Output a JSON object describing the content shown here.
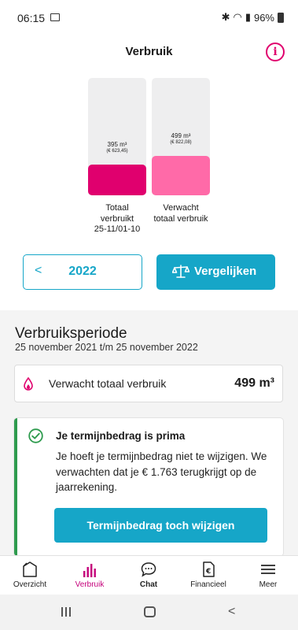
{
  "status_bar": {
    "time": "06:15",
    "battery": "96%"
  },
  "header": {
    "title": "Verbruik",
    "info_icon": "info-icon"
  },
  "chart_data": {
    "type": "bar",
    "categories": [
      "Totaal verbruikt 25-11/01-10",
      "Verwacht totaal verbruik"
    ],
    "values": [
      395,
      499
    ],
    "value_labels": [
      "395 m³",
      "499 m³"
    ],
    "cost_labels": [
      "(€ 623,45)",
      "(€ 822,08)"
    ],
    "category_lines": [
      [
        "Totaal",
        "verbruikt",
        "25-11/01-10"
      ],
      [
        "Verwacht",
        "totaal verbruik"
      ]
    ],
    "colors": [
      "#e0006e",
      "#ff6aa8"
    ],
    "ylim": [
      0,
      1500
    ]
  },
  "controls": {
    "year": "2022",
    "compare_label": "Vergelijken"
  },
  "period": {
    "title": "Verbruiksperiode",
    "range": "25 november 2021 t/m 25 november 2022",
    "usage_label": "Verwacht totaal verbruik",
    "usage_value": "499 m³"
  },
  "advice": {
    "heading": "Je termijnbedrag is prima",
    "body": "Je hoeft je termijnbedrag niet te wijzigen. We verwachten dat je € 1.763 terugkrijgt op de jaarrekening.",
    "cta": "Termijnbedrag toch wijzigen"
  },
  "bottom_nav": [
    {
      "label": "Overzicht",
      "icon": "house-icon"
    },
    {
      "label": "Verbruik",
      "icon": "bar-chart-icon"
    },
    {
      "label": "Chat",
      "icon": "chat-icon"
    },
    {
      "label": "Financieel",
      "icon": "euro-doc-icon"
    },
    {
      "label": "Meer",
      "icon": "menu-icon"
    }
  ],
  "accent": "#16a6c8",
  "brand": "#e0006e"
}
